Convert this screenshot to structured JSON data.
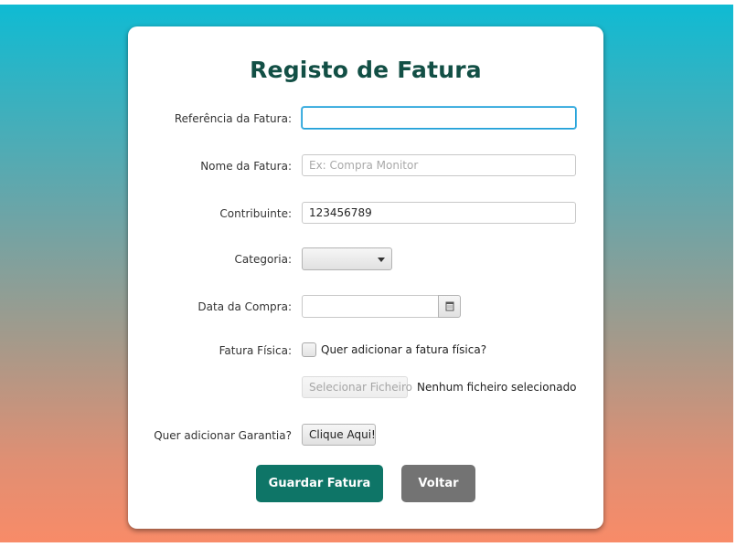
{
  "form": {
    "title": "Registo de Fatura",
    "reference": {
      "label": "Referência da Fatura:",
      "value": "",
      "placeholder": ""
    },
    "name": {
      "label": "Nome da Fatura:",
      "value": "",
      "placeholder": "Ex: Compra Monitor"
    },
    "taxpayer": {
      "label": "Contribuinte:",
      "value": "123456789"
    },
    "category": {
      "label": "Categoria:",
      "selected": ""
    },
    "purchase_date": {
      "label": "Data da Compra:",
      "value": ""
    },
    "physical_invoice": {
      "label": "Fatura Física:",
      "checkbox_label": "Quer adicionar a fatura física?",
      "checked": false,
      "select_file_label": "Selecionar Ficheiro",
      "file_status": "Nenhum ficheiro selecionado"
    },
    "warranty": {
      "label": "Quer adicionar Garantia?",
      "button_label": "Clique Aqui!"
    },
    "save_label": "Guardar Fatura",
    "back_label": "Voltar"
  },
  "colors": {
    "title": "#124f45",
    "primary_button": "#0e7567",
    "secondary_button": "#737373",
    "focus_ring": "#1f9fd6",
    "gradient_top": "#0fbbd3",
    "gradient_bottom": "#f88b68"
  },
  "icons": {
    "combo_arrow": "chevron-down-icon",
    "date_picker": "calendar-icon"
  }
}
